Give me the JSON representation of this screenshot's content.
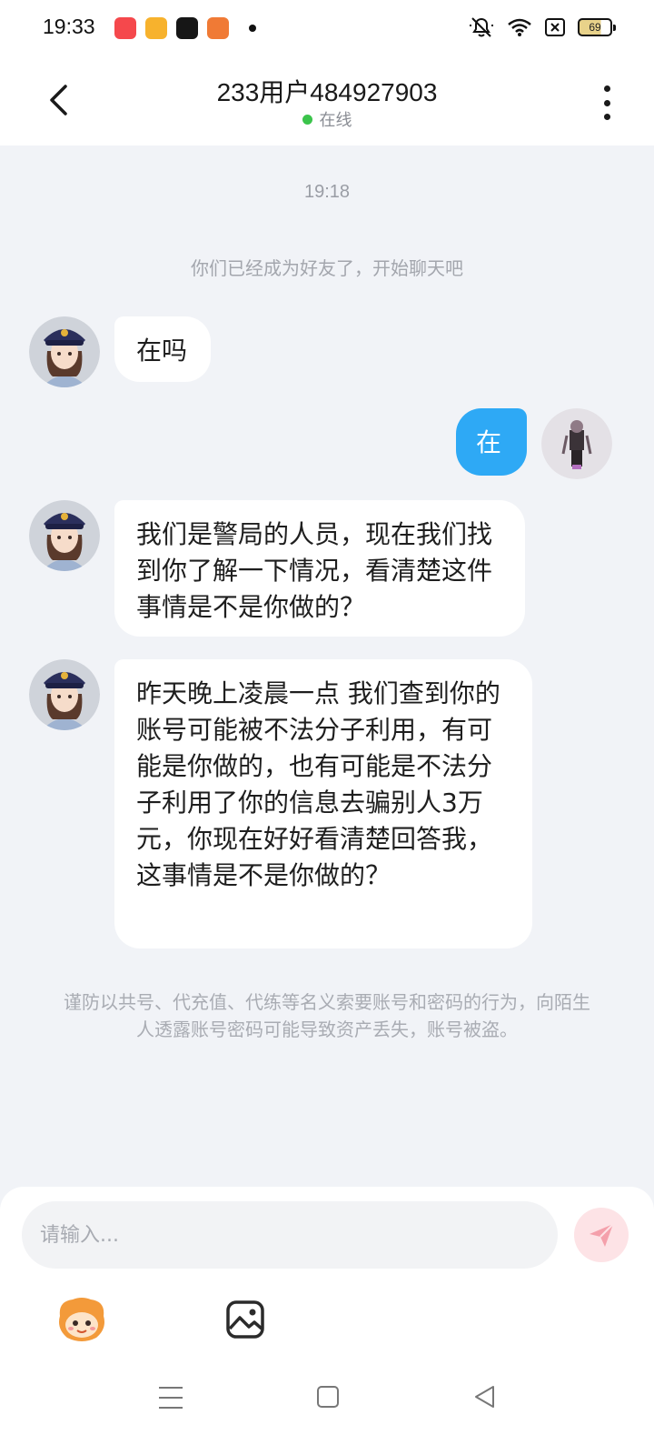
{
  "status_bar": {
    "time": "19:33",
    "battery": "69",
    "app_icons": [
      "xiaohongshu-app-icon",
      "video-app-icon",
      "douyin-app-icon",
      "reader-app-icon"
    ],
    "status_icons": [
      "mute-icon",
      "wifi-icon",
      "sim-icon",
      "battery-icon"
    ]
  },
  "header": {
    "title": "233用户484927903",
    "status": "在线",
    "status_color": "#3bc44b"
  },
  "chat": {
    "timestamp": "19:18",
    "system_message": "你们已经成为好友了，开始聊天吧",
    "messages": [
      {
        "side": "left",
        "text": "在吗"
      },
      {
        "side": "right",
        "text": "在"
      },
      {
        "side": "left",
        "text": "我们是警局的人员，现在我们找到你了解一下情况，看清楚这件事情是不是你做的？"
      },
      {
        "side": "left",
        "text": "昨天晚上凌晨一点 我们查到你的账号可能被不法分子利用，有可能是你做的，也有可能是不法分子利用了你的信息去骗别人3万元，你现在好好看清楚回答我，这事情是不是你做的？"
      }
    ],
    "safety_notice": "谨防以共号、代充值、代练等名义索要账号和密码的行为，向陌生人透露账号密码可能导致资产丢失，账号被盗。"
  },
  "input": {
    "placeholder": "请输入..."
  },
  "colors": {
    "accent_blue": "#2ea9f5",
    "background": "#f1f3f7",
    "send_button_bg": "#fde3e6",
    "send_icon": "#f4a0ab"
  }
}
